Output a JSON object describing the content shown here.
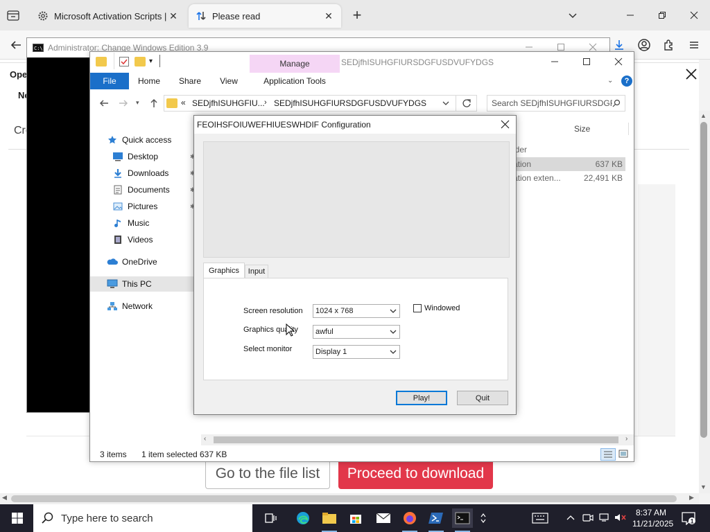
{
  "browser": {
    "tabs": [
      {
        "title": "Microsoft Activation Scripts | M",
        "active": false
      },
      {
        "title": "Please read",
        "active": true
      }
    ],
    "new_tab_symbol": "+",
    "page": {
      "notice_title_fragment": "Ope",
      "notice_sub_fragment": "No",
      "cre_fragment": "Cre",
      "file_list_button": "Go to the file list",
      "download_button": "Proceed to download",
      "download_color": "#e2374a"
    }
  },
  "console": {
    "title": "Administrator:  Change Windows Edition 3.9"
  },
  "explorer": {
    "title": "SEDjfhISUHGFIURSDGFUSDVUFYDGS",
    "manage_label": "Manage",
    "ribbon_tabs": [
      "File",
      "Home",
      "Share",
      "View",
      "Application Tools"
    ],
    "address_chevron": "«",
    "address_parts": [
      "SEDjfhISUHGFIU...",
      "SEDjfhISUHGFIURSDGFUSDVUFYDGS"
    ],
    "search_placeholder": "Search SEDjfhISUHGFIURSDGF...",
    "nav": {
      "quick_access": "Quick access",
      "items": [
        "Desktop",
        "Downloads",
        "Documents",
        "Pictures",
        "Music",
        "Videos"
      ],
      "onedrive": "OneDrive",
      "this_pc": "This PC",
      "network": "Network"
    },
    "columns": {
      "size": "Size"
    },
    "files": [
      {
        "type_fragment": "lder",
        "size": ""
      },
      {
        "type_fragment": "ation",
        "size": "637 KB"
      },
      {
        "type_fragment": "ation exten...",
        "size": "22,491 KB"
      }
    ],
    "status": {
      "items": "3 items",
      "selected": "1 item selected",
      "size": "637 KB"
    },
    "accent": "#1a6fc9"
  },
  "dialog": {
    "title": "FEOIHSFOIUWEFHIUESWHDIF Configuration",
    "tabs": [
      "Graphics",
      "Input"
    ],
    "fields": {
      "resolution_label": "Screen resolution",
      "resolution_value": "1024 x 768",
      "quality_label": "Graphics quality",
      "quality_value": "awful",
      "monitor_label": "Select monitor",
      "monitor_value": "Display 1",
      "windowed_label": "Windowed",
      "windowed_checked": false
    },
    "buttons": {
      "play": "Play!",
      "quit": "Quit"
    }
  },
  "taskbar": {
    "search_placeholder": "Type here to search",
    "time": "8:37 AM",
    "date": "11/21/2025"
  }
}
